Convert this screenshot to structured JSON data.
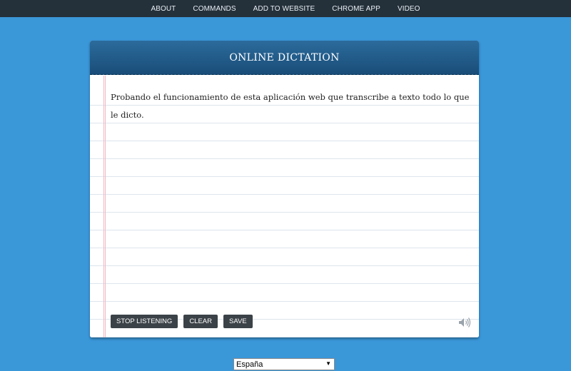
{
  "nav": {
    "items": [
      {
        "label": "ABOUT"
      },
      {
        "label": "COMMANDS"
      },
      {
        "label": "ADD TO WEBSITE"
      },
      {
        "label": "CHROME APP"
      },
      {
        "label": "VIDEO"
      }
    ]
  },
  "panel": {
    "title": "ONLINE DICTATION",
    "text": "Probando el funcionamiento de esta aplicación web que transcribe a texto todo lo que le dicto."
  },
  "buttons": {
    "stop_label": "STOP LISTENING",
    "clear_label": "CLEAR",
    "save_label": "SAVE"
  },
  "icons": {
    "speaker": "speaker-icon",
    "dropdown": "chevron-down-icon"
  },
  "language": {
    "selected": "España",
    "arrow": "▼"
  },
  "colors": {
    "background": "#3a97d8",
    "nav": "#24303a",
    "header": "#1a4d78",
    "button": "#3b4248"
  }
}
